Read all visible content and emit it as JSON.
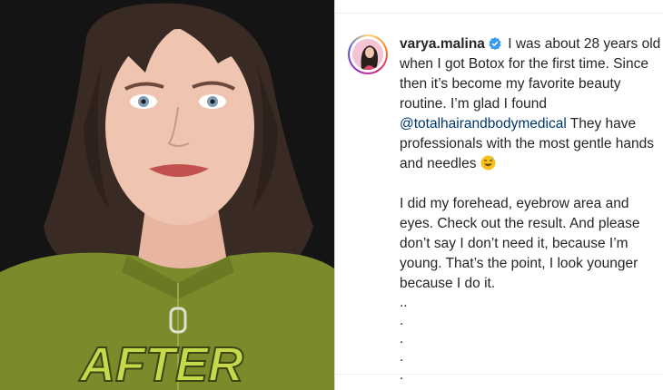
{
  "post": {
    "username": "varya.malina",
    "verified": true,
    "caption_part1": "I was about 28 years old when I got Botox for the first time. Since then it’s become my favorite beauty routine. I’m glad I found",
    "mention": "@totalhairandbodymedical",
    "caption_part2": "They have professionals with the most gentle hands and needles",
    "emoji": "😅",
    "paragraph2": "I did my forehead, eyebrow area and eyes. Check out the result. And please don’t say I don’t need it, because I’m young. That’s the point, I look younger because I do it.",
    "dots": [
      "..",
      ".",
      ".",
      ".",
      "."
    ]
  },
  "image": {
    "shirt_text": "AFTER",
    "shirt_color": "#7b8b2c",
    "text_color": "#c5d94a"
  },
  "colors": {
    "mention": "#00376b",
    "verified_badge": "#3897f0"
  }
}
